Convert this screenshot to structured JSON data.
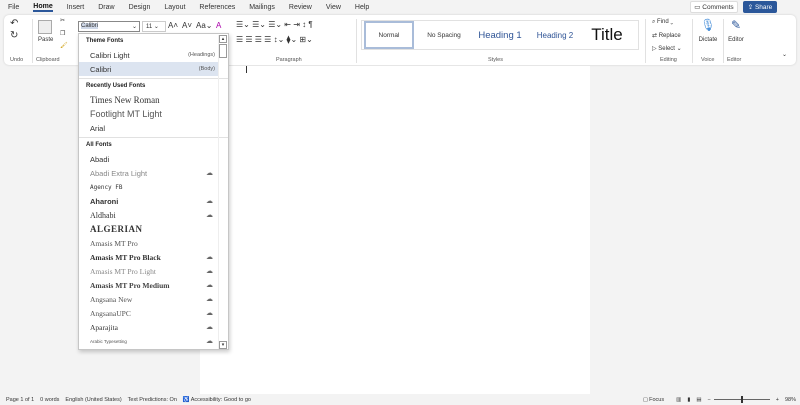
{
  "menu": [
    "File",
    "Home",
    "Insert",
    "Draw",
    "Design",
    "Layout",
    "References",
    "Mailings",
    "Review",
    "View",
    "Help"
  ],
  "comments": "Comments",
  "share": "Share",
  "ribbon": {
    "undo_label": "Undo",
    "clipboard_label": "Clipboard",
    "paste": "Paste",
    "font_value": "Calibri",
    "size_value": "11",
    "paragraph_label": "Paragraph",
    "styles_label": "Styles",
    "editing_label": "Editing",
    "voice_label": "Voice",
    "editor_group_label": "Editor",
    "styles": [
      "Normal",
      "No Spacing",
      "Heading 1",
      "Heading 2",
      "Title"
    ],
    "find": "Find",
    "replace": "Replace",
    "select": "Select",
    "dictate": "Dictate",
    "editor": "Editor"
  },
  "font_dropdown": {
    "theme_header": "Theme Fonts",
    "theme": [
      {
        "name": "Calibri Light",
        "tag": "(Headings)"
      },
      {
        "name": "Calibri",
        "tag": "(Body)"
      }
    ],
    "recent_header": "Recently Used Fonts",
    "recent": [
      "Times New Roman",
      "Footlight MT Light",
      "Arial"
    ],
    "all_header": "All Fonts",
    "all": [
      "Abadi",
      "Abadi Extra Light",
      "Agency FB",
      "Aharoni",
      "Aldhabi",
      "ALGERIAN",
      "Amasis MT Pro",
      "Amasis MT Pro Black",
      "Amasis MT Pro Light",
      "Amasis MT Pro Medium",
      "Angsana New",
      "AngsanaUPC",
      "Aparajita",
      "Arabic Typesetting"
    ]
  },
  "status": {
    "page": "Page 1 of 1",
    "words": "0 words",
    "lang": "English (United States)",
    "predictions": "Text Predictions: On",
    "accessibility": "Accessibility: Good to go",
    "focus": "Focus",
    "zoom": "98%"
  },
  "zoom_level": 98
}
